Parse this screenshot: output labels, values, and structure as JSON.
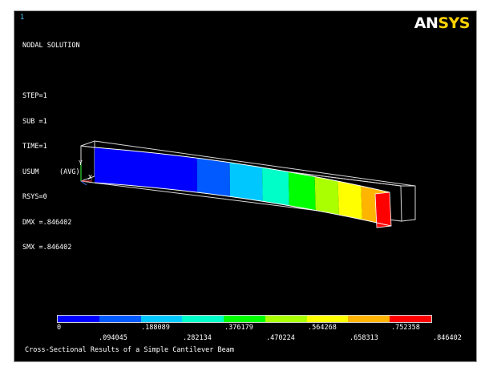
{
  "window_number": "1",
  "logo": {
    "part1": "AN",
    "part2": "SYS"
  },
  "solution": {
    "lines": [
      "NODAL SOLUTION",
      "",
      "STEP=1",
      "SUB =1",
      "TIME=1",
      "USUM     (AVG)",
      "RSYS=0",
      "DMX =.846402",
      "SMX =.846402"
    ]
  },
  "triad": {
    "x": "X",
    "y": "Y"
  },
  "contour_colors": [
    "#0000ff",
    "#005aff",
    "#00c8ff",
    "#00ffc8",
    "#00ff00",
    "#aaff00",
    "#ffff00",
    "#ffb400",
    "#ff0000"
  ],
  "legend_values_top": [
    "0",
    ".188089",
    ".376179",
    ".564268",
    ".752358"
  ],
  "legend_values_bottom": [
    ".094045",
    ".282134",
    ".470224",
    ".658313",
    ".846402"
  ],
  "title": "Cross-Sectional Results of a Simple Cantilever Beam"
}
